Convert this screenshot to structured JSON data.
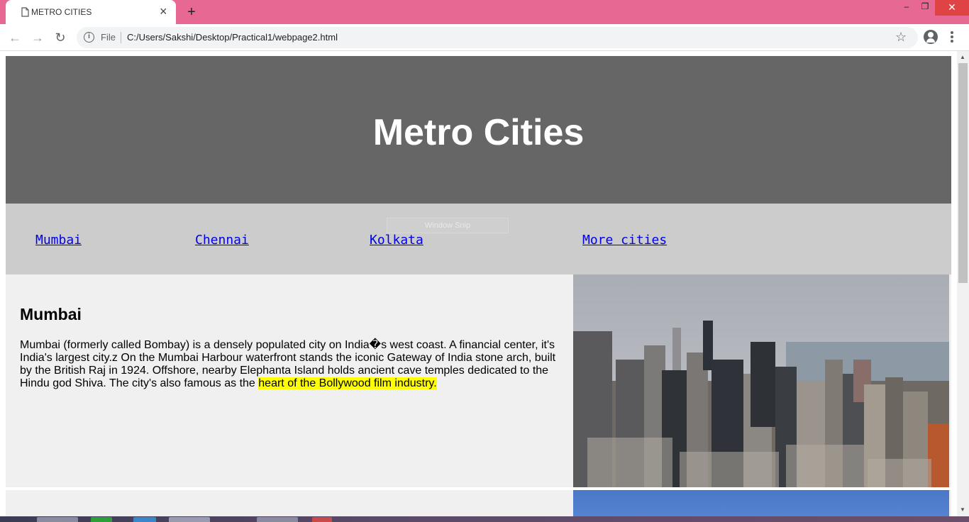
{
  "browser": {
    "tab_title": "METRO CITIES",
    "tab_close": "×",
    "new_tab": "+",
    "file_label": "File",
    "url": "C:/Users/Sakshi/Desktop/Practical1/webpage2.html",
    "window_controls": {
      "minimize": "‒",
      "maximize": "❐",
      "close": "✕"
    }
  },
  "page": {
    "title": "Metro Cities",
    "nav": [
      "Mumbai",
      "Chennai",
      "Kolkata",
      "More cities"
    ],
    "overlay": "Window Snip",
    "section": {
      "heading": "Mumbai",
      "text_before": "Mumbai (formerly called Bombay) is a densely populated city on India�s west coast. A financial center, it's India's largest city.z On the Mumbai Harbour waterfront stands the iconic Gateway of India stone arch, built by the British Raj in 1924. Offshore, nearby Elephanta Island holds ancient cave temples dedicated to the Hindu god Shiva. The city's also famous as the ",
      "highlight": "heart of the Bollywood film industry."
    }
  },
  "colors": {
    "tab_strip": "#e76892",
    "header_bg": "#666666",
    "nav_bg": "#cccccc",
    "section_bg": "#f0f0f0",
    "link": "#0000ee",
    "highlight": "#ffff00"
  }
}
